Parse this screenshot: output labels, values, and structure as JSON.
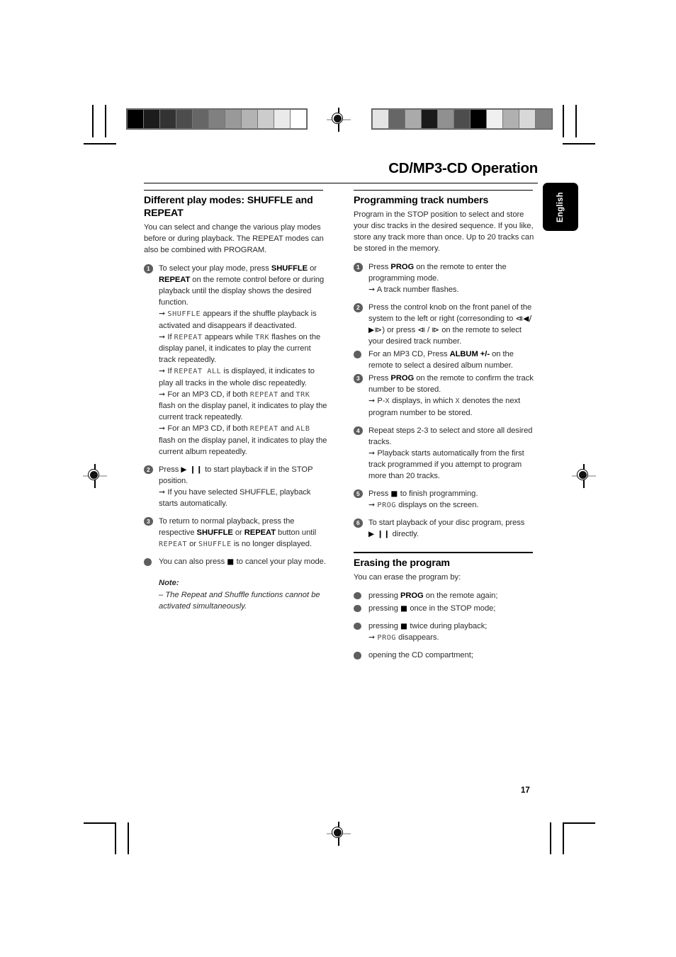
{
  "header": {
    "title": "CD/MP3-CD Operation",
    "language_tab": "English"
  },
  "page_number": "17",
  "print_marks": {
    "grayscale_strip_left": [
      "#000000",
      "#1c1c1c",
      "#333333",
      "#4d4d4d",
      "#666666",
      "#808080",
      "#999999",
      "#b3b3b3",
      "#cccccc",
      "#eaeaea",
      "#ffffff"
    ],
    "grayscale_strip_right": [
      "#e4e4e4",
      "#666666",
      "#aaaaaa",
      "#1a1a1a",
      "#909090",
      "#4d4d4d",
      "#000000",
      "#f0f0f0",
      "#b0b0b0",
      "#d8d8d8",
      "#808080"
    ]
  },
  "left_column": {
    "section1": {
      "title": "Different play modes: SHUFFLE and REPEAT",
      "intro": "You can select and change the various play modes before or during playback. The REPEAT modes can also be combined with PROGRAM.",
      "step1_marker": "1",
      "step1_line1_a": "To select your play mode, press ",
      "step1_line1_b": "SHUFFLE",
      "step1_line1_c": " or ",
      "step1_line1_d": "REPEAT",
      "step1_line1_e": " on the remote control before or during playback until the display shows the desired function.",
      "step1_sub1_lcd": "SHUFFLE",
      "step1_sub1_text": " appears if the shuffle playback is activated and disappears if deactivated.",
      "step1_sub2_pre": "If ",
      "step1_sub2_lcd1": "REPEAT",
      "step1_sub2_mid": " appears while ",
      "step1_sub2_lcd2": "TRK",
      "step1_sub2_text": " flashes on the display panel, it indicates to play the current track repeatedly.",
      "step1_sub3_pre": "If ",
      "step1_sub3_lcd": "REPEAT ALL",
      "step1_sub3_text": " is displayed, it indicates to play all tracks in the whole disc repeatedly.",
      "step1_sub4_pre": "For an MP3 CD, if both ",
      "step1_sub4_lcd1": "REPEAT",
      "step1_sub4_mid": " and ",
      "step1_sub4_lcd2": "TRK",
      "step1_sub4_text": " flash on the display panel, it indicates to play the current track repeatedly.",
      "step1_sub5_pre": "For an MP3 CD, if both ",
      "step1_sub5_lcd1": "REPEAT",
      "step1_sub5_mid": " and ",
      "step1_sub5_lcd2": "ALB",
      "step1_sub5_text": " flash on the display panel, it indicates to play the current album repeatedly.",
      "step2_marker": "2",
      "step2_pre": "Press ",
      "step2_symbol": "▶ ❙❙",
      "step2_text": " to start playback if in the STOP position.",
      "step2_sub1": "If you have selected SHUFFLE, playback starts automatically.",
      "step3_marker": "3",
      "step3_pre": "To return to normal playback, press the respective ",
      "step3_b1": "SHUFFLE",
      "step3_mid": " or ",
      "step3_b2": "REPEAT",
      "step3_post": " button until ",
      "step3_lcd1": "REPEAT",
      "step3_or": " or ",
      "step3_lcd2": "SHUFFLE",
      "step3_end": " is no longer displayed.",
      "bullet1_pre": "You can also press ",
      "bullet1_symbol": "■",
      "bullet1_post": " to cancel your play mode.",
      "note_heading": "Note:",
      "note_body": "–  The Repeat and Shuffle functions cannot be activated simultaneously."
    }
  },
  "right_column": {
    "section1": {
      "title": "Programming track numbers",
      "intro": "Program in the STOP position to select and store your disc tracks in the desired sequence. If you like, store any track more than once. Up to 20 tracks can be stored in the memory.",
      "step1_marker": "1",
      "step1_pre": "Press ",
      "step1_b": "PROG",
      "step1_post": " on the remote to enter the programming mode.",
      "step1_sub1": "A track number flashes.",
      "step2_marker": "2",
      "step2_text_a": "Press the control knob on the front panel of the system to the left or right (corresonding to ",
      "step2_sym_a": "⧏◀/▶⧐",
      "step2_text_b": ") or press ",
      "step2_sym_b": "⧏",
      "step2_text_c": " / ",
      "step2_sym_c": "⧐",
      "step2_text_d": " on the remote to select your desired track number.",
      "bullet1_pre": "For an MP3 CD,  Press ",
      "bullet1_b": "ALBUM +/-",
      "bullet1_post": " on the remote to select a desired album number.",
      "step3_marker": "3",
      "step3_pre": "Press ",
      "step3_b": "PROG",
      "step3_post": " on the remote to confirm the track number to be stored.",
      "step3_sub_pre": "P-",
      "step3_sub_lcd1": "X",
      "step3_sub_mid": " displays, in which ",
      "step3_sub_lcd2": "X",
      "step3_sub_post": " denotes the next program number to be stored.",
      "step4_marker": "4",
      "step4_text": "Repeat steps 2-3 to select and store all desired tracks.",
      "step4_sub1": "Playback starts automatically from the first track programmed if you attempt to program more than 20 tracks.",
      "step5_marker": "5",
      "step5_pre": "Press ",
      "step5_symbol": "■",
      "step5_post": " to finish programming.",
      "step5_sub_lcd": "PROG",
      "step5_sub_text": " displays on the screen.",
      "step6_marker": "6",
      "step6_pre": "To start playback of your disc program, press ",
      "step6_symbol": "▶ ❙❙",
      "step6_post": " directly."
    },
    "section2": {
      "title": "Erasing the program",
      "intro": "You can erase the program by:",
      "bullet1_pre": "pressing ",
      "bullet1_b": "PROG",
      "bullet1_post": " on the remote again;",
      "bullet2_pre": "pressing ",
      "bullet2_symbol": "■",
      "bullet2_post": " once in the STOP mode;",
      "bullet3_pre": "pressing ",
      "bullet3_symbol": "■",
      "bullet3_post": " twice during playback;",
      "bullet3_sub_lcd": "PROG",
      "bullet3_sub_text": " disappears.",
      "bullet4": "opening the CD compartment;"
    }
  }
}
